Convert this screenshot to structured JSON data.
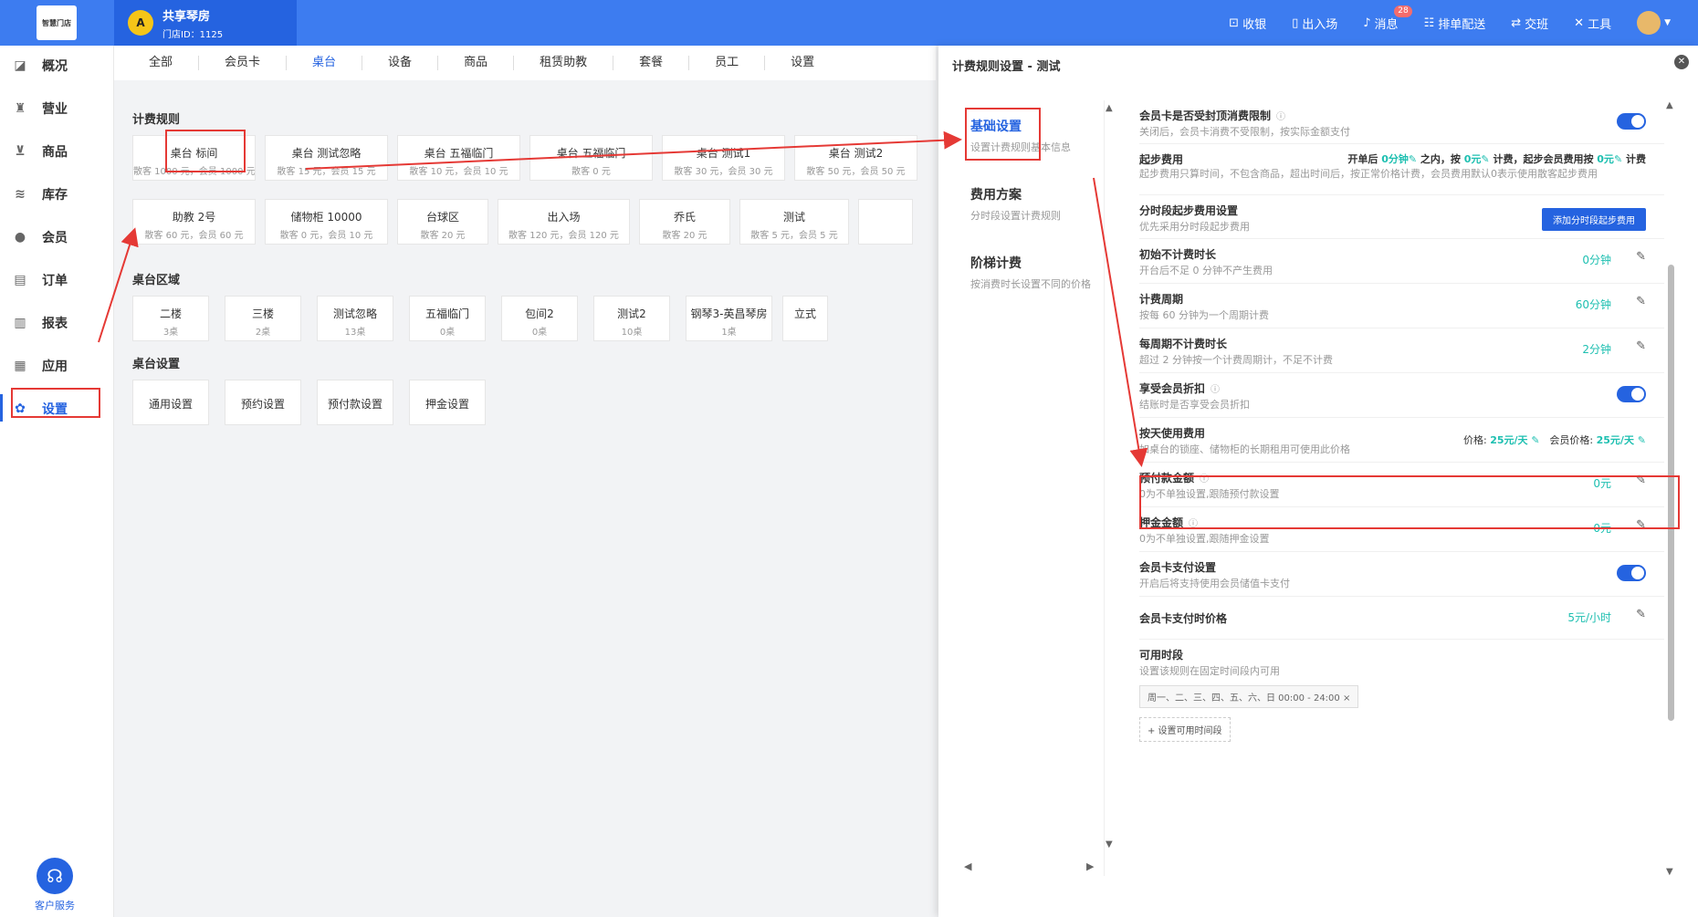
{
  "header": {
    "logo_text": "智慧门店",
    "store_avatar": "A",
    "store_name": "共享琴房",
    "store_id": "门店ID：1125",
    "actions": [
      {
        "icon": "cash-icon",
        "glyph": "⊡",
        "label": "收银"
      },
      {
        "icon": "door-icon",
        "glyph": "▯",
        "label": "出入场"
      },
      {
        "icon": "bell-icon",
        "glyph": "♪",
        "label": "消息",
        "badge": "28"
      },
      {
        "icon": "schedule-icon",
        "glyph": "☷",
        "label": "排单配送"
      },
      {
        "icon": "handover-icon",
        "glyph": "⇄",
        "label": "交班"
      },
      {
        "icon": "tools-icon",
        "glyph": "✕",
        "label": "工具"
      }
    ]
  },
  "sidebar": {
    "items": [
      {
        "icon": "chart-icon",
        "glyph": "◪",
        "label": "概况"
      },
      {
        "icon": "business-icon",
        "glyph": "♜",
        "label": "营业"
      },
      {
        "icon": "cart-icon",
        "glyph": "⊻",
        "label": "商品"
      },
      {
        "icon": "stack-icon",
        "glyph": "≋",
        "label": "库存"
      },
      {
        "icon": "member-icon",
        "glyph": "●",
        "label": "会员"
      },
      {
        "icon": "order-icon",
        "glyph": "▤",
        "label": "订单"
      },
      {
        "icon": "report-icon",
        "glyph": "▥",
        "label": "报表"
      },
      {
        "icon": "apps-icon",
        "glyph": "▦",
        "label": "应用"
      },
      {
        "icon": "settings-icon",
        "glyph": "✿",
        "label": "设置"
      }
    ],
    "service_label": "客户服务"
  },
  "tabs": [
    "全部",
    "会员卡",
    "桌台",
    "设备",
    "商品",
    "租赁助教",
    "套餐",
    "员工",
    "设置"
  ],
  "sections": {
    "billing_rules": "计费规则",
    "table_area": "桌台区域",
    "table_settings": "桌台设置"
  },
  "billing_cards_row1": [
    {
      "t": "桌台 标间",
      "s": "散客 1000 元，会员 1000 元"
    },
    {
      "t": "桌台 测试忽略",
      "s": "散客 15 元，会员 15 元"
    },
    {
      "t": "桌台 五福临门",
      "s": "散客 10 元，会员 10 元"
    },
    {
      "t": "桌台 五福临门",
      "s": "散客 0 元"
    },
    {
      "t": "桌台 测试1",
      "s": "散客 30 元，会员 30 元"
    },
    {
      "t": "桌台 测试2",
      "s": "散客 50 元，会员 50 元"
    }
  ],
  "billing_cards_row2": [
    {
      "t": "助教 2号",
      "s": "散客 60 元，会员 60 元"
    },
    {
      "t": "储物柜 10000",
      "s": "散客 0 元，会员 10 元"
    },
    {
      "t": "台球区",
      "s": "散客 20 元"
    },
    {
      "t": "出入场",
      "s": "散客 120 元，会员 120 元"
    },
    {
      "t": "乔氏",
      "s": "散客 20 元"
    },
    {
      "t": "测试",
      "s": "散客 5 元，会员 5 元"
    }
  ],
  "area_cards": [
    {
      "t": "二楼",
      "s": "3桌"
    },
    {
      "t": "三楼",
      "s": "2桌"
    },
    {
      "t": "测试忽略",
      "s": "13桌"
    },
    {
      "t": "五福临门",
      "s": "0桌"
    },
    {
      "t": "包间2",
      "s": "0桌"
    },
    {
      "t": "测试2",
      "s": "10桌"
    },
    {
      "t": "钢琴3-英昌琴房",
      "s": "1桌"
    },
    {
      "t": "立式",
      "s": ""
    }
  ],
  "setting_cards": [
    "通用设置",
    "预约设置",
    "预付款设置",
    "押金设置"
  ],
  "panel": {
    "title": "计费规则设置 - 测试",
    "nav": [
      {
        "t": "基础设置",
        "s": "设置计费规则基本信息"
      },
      {
        "t": "费用方案",
        "s": "分时段设置计费规则"
      },
      {
        "t": "阶梯计费",
        "s": "按消费时长设置不同的价格"
      }
    ],
    "rows": {
      "member_cap": {
        "t": "会员卡是否受封顶消费限制",
        "s": "关闭后，会员卡消费不受限制，按实际金额支付"
      },
      "start_fee": {
        "t": "起步费用",
        "s": "起步费用只算时间，不包含商品，超出时间后，按正常价格计费，会员费用默认0表示使用散客起步费用",
        "p1": "开单后 ",
        "v1": "0分钟",
        "p2": " 之内，按 ",
        "v2": "0元",
        "p3": " 计费，起步会员费用按 ",
        "v3": "0元",
        "p4": " 计费"
      },
      "segment_start": {
        "t": "分时段起步费用设置",
        "s": "优先采用分时段起步费用",
        "btn": "添加分时段起步费用"
      },
      "initial_free": {
        "t": "初始不计费时长",
        "s": "开台后不足 0 分钟不产生费用",
        "v": "0分钟"
      },
      "cycle": {
        "t": "计费周期",
        "s": "按每 60 分钟为一个周期计费",
        "v": "60分钟"
      },
      "cycle_free": {
        "t": "每周期不计费时长",
        "s": "超过 2 分钟按一个计费周期计，不足不计费",
        "v": "2分钟"
      },
      "member_discount": {
        "t": "享受会员折扣",
        "s": "结账时是否享受会员折扣"
      },
      "daily_fee": {
        "t": "按天使用费用",
        "s": "如桌台的锁座、储物柜的长期租用可使用此价格",
        "pl": "价格: ",
        "v1": "25元/天",
        "ml": "会员价格: ",
        "v2": "25元/天"
      },
      "prepay": {
        "t": "预付款金额",
        "s": "0为不单独设置,跟随预付款设置",
        "v": "0元"
      },
      "deposit": {
        "t": "押金金额",
        "s": "0为不单独设置,跟随押金设置",
        "v": "0元"
      },
      "card_pay": {
        "t": "会员卡支付设置",
        "s": "开启后将支持使用会员储值卡支付"
      },
      "card_price": {
        "t": "会员卡支付时价格",
        "v": "5元/小时"
      },
      "available": {
        "t": "可用时段",
        "s": "设置该规则在固定时间段内可用",
        "chip": "周一、二、三、四、五、六、日 00:00 - 24:00",
        "add": "+ 设置可用时间段"
      }
    }
  },
  "colors": {
    "primary": "#2563e0",
    "topbar": "#3d7cf0",
    "value": "#1cbfb0",
    "annotation": "#e53935"
  }
}
